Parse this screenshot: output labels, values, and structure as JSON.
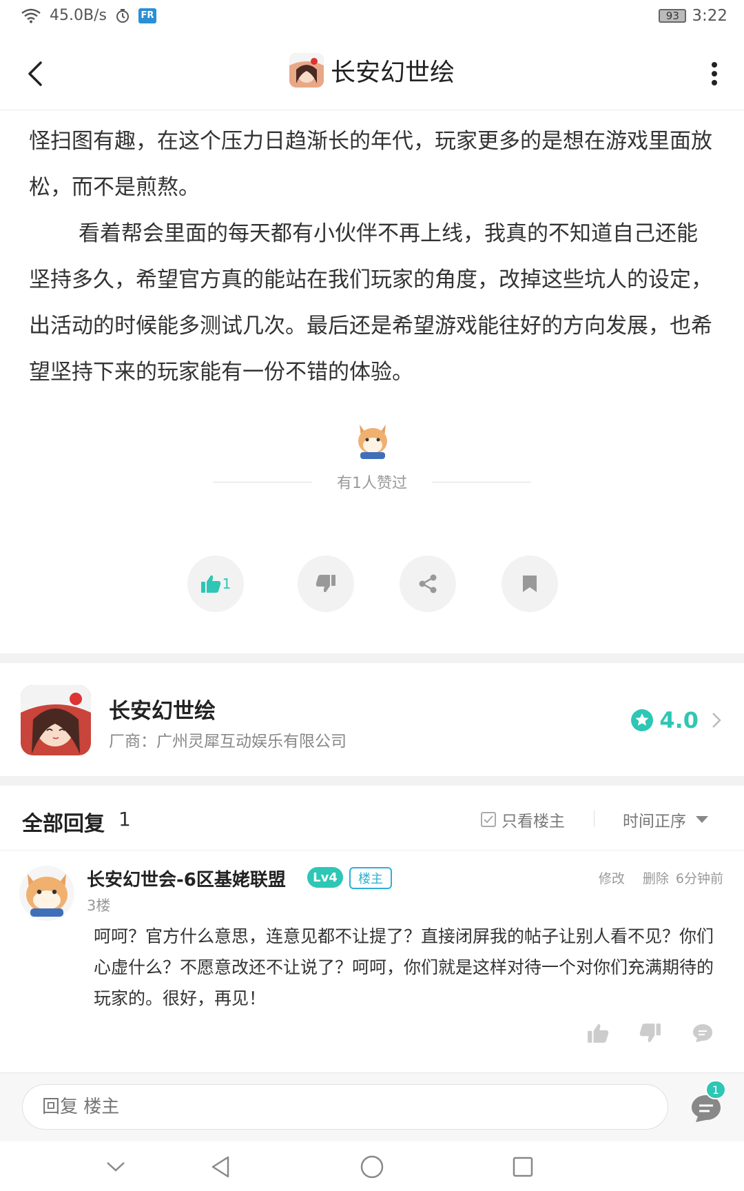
{
  "status_bar": {
    "net_speed": "45.0B/s",
    "fr_badge": "FR",
    "battery": "93",
    "time": "3:22"
  },
  "header": {
    "title": "长安幻世绘",
    "icons": [
      "back-arrow-icon",
      "game-icon",
      "more-vert-icon"
    ]
  },
  "article": {
    "paragraphs": [
      "怪扫图有趣，在这个压力日趋渐长的年代，玩家更多的是想在游戏里面放松，而不是煎熬。",
      "看着帮会里面的每天都有小伙伴不再上线，我真的不知道自己还能坚持多久，希望官方真的能站在我们玩家的角度，改掉这些坑人的设定，出活动的时候能多测试几次。最后还是希望游戏能往好的方向发展，也希望坚持下来的玩家能有一份不错的体验。"
    ]
  },
  "likers": {
    "text": "有1人赞过"
  },
  "actions": {
    "like_count": "1",
    "icons": [
      "thumbs-up-icon",
      "thumbs-down-icon",
      "share-icon",
      "bookmark-icon"
    ]
  },
  "game_card": {
    "name": "长安幻世绘",
    "vendor": "厂商：广州灵犀互动娱乐有限公司",
    "rating": "4.0"
  },
  "replies": {
    "title": "全部回复",
    "count": "1",
    "only_op": "只看楼主",
    "sort": "时间正序",
    "items": [
      {
        "name": "长安幻世会-6区基姥联盟",
        "level": "Lv4",
        "op_badge": "楼主",
        "edit": "修改",
        "delete": "删除",
        "time": "6分钟前",
        "floor": "3楼",
        "content": "呵呵？官方什么意思，连意见都不让提了？直接闭屏我的帖子让别人看不见？你们心虚什么？不愿意改还不让说了？呵呵，你们就是这样对待一个对你们充满期待的玩家的。很好，再见！"
      }
    ]
  },
  "input_bar": {
    "placeholder": "回复 楼主",
    "comment_badge": "1"
  },
  "colors": {
    "accent": "#2ec6b4",
    "op_blue": "#2bb0d6"
  }
}
